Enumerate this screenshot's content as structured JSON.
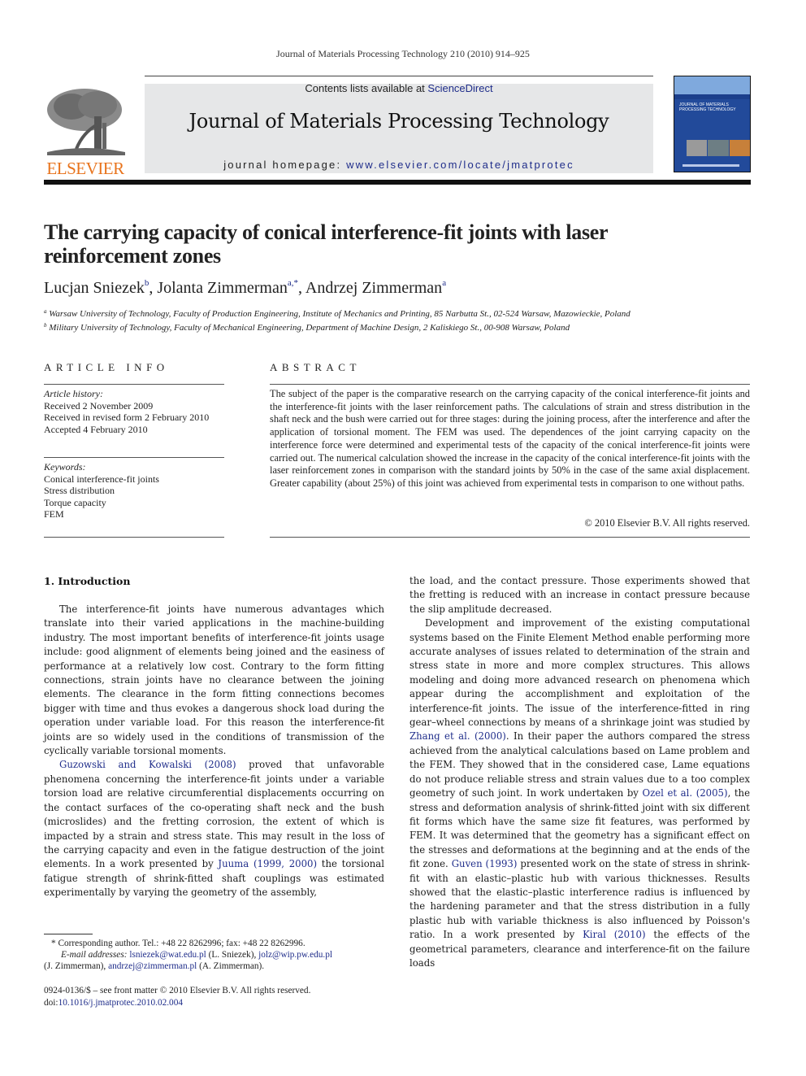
{
  "running_head": "Journal of Materials Processing Technology 210 (2010) 914–925",
  "masthead": {
    "publisher_logo_text": "ELSEVIER",
    "contents_prefix": "Contents lists available at ",
    "contents_link": "ScienceDirect",
    "journal_name": "Journal of Materials Processing Technology",
    "homepage_prefix": "journal homepage: ",
    "homepage_link": "www.elsevier.com/locate/jmatprotec",
    "cover_title_line1": "JOURNAL OF MATERIALS",
    "cover_title_line2": "PROCESSING TECHNOLOGY",
    "brand_color": "#e8731c",
    "link_color": "#1f2d8a",
    "band_color": "#e6e7e8"
  },
  "article": {
    "title": "The carrying capacity of conical interference-fit joints with laser reinforcement zones",
    "authors": [
      {
        "name": "Lucjan Sniezek",
        "sup": "b"
      },
      {
        "name": "Jolanta Zimmerman",
        "sup": "a,*"
      },
      {
        "name": "Andrzej Zimmerman",
        "sup": "a"
      }
    ],
    "affiliations": [
      {
        "mark": "a",
        "text": "Warsaw University of Technology, Faculty of Production Engineering, Institute of Mechanics and Printing, 85 Narbutta St., 02-524 Warsaw, Mazowieckie, Poland"
      },
      {
        "mark": "b",
        "text": "Military University of Technology, Faculty of Mechanical Engineering, Department of Machine Design, 2 Kaliskiego St., 00-908 Warsaw, Poland"
      }
    ]
  },
  "article_info": {
    "heading": "ARTICLE INFO",
    "history_label": "Article history:",
    "history": [
      "Received 2 November 2009",
      "Received in revised form 2 February 2010",
      "Accepted 4 February 2010"
    ],
    "keywords_label": "Keywords:",
    "keywords": [
      "Conical interference-fit joints",
      "Stress distribution",
      "Torque capacity",
      "FEM"
    ]
  },
  "abstract": {
    "heading": "ABSTRACT",
    "text": "The subject of the paper is the comparative research on the carrying capacity of the conical interference-fit joints and the interference-fit joints with the laser reinforcement paths. The calculations of strain and stress distribution in the shaft neck and the bush were carried out for three stages: during the joining process, after the interference and after the application of torsional moment. The FEM was used. The dependences of the joint carrying capacity on the interference force were determined and experimental tests of the capacity of the conical interference-fit joints were carried out. The numerical calculation showed the increase in the capacity of the conical interference-fit joints with the laser reinforcement zones in comparison with the standard joints by 50% in the case of the same axial displacement. Greater capability (about 25%) of this joint was achieved from experimental tests in comparison to one without paths.",
    "copyright": "© 2010 Elsevier B.V. All rights reserved."
  },
  "body": {
    "section_heading": "1.  Introduction",
    "p1": "The interference-fit joints have numerous advantages which translate into their varied applications in the machine-building industry. The most important benefits of interference-fit joints usage include: good alignment of elements being joined and the easiness of performance at a relatively low cost. Contrary to the form fitting connections, strain joints have no clearance between the joining elements. The clearance in the form fitting connections becomes bigger with time and thus evokes a dangerous shock load during the operation under variable load. For this reason the interference-fit joints are so widely used in the conditions of transmission of the cyclically variable torsional moments.",
    "p2_link1": "Guzowski and Kowalski (2008)",
    "p2_a": " proved that unfavorable phenomena concerning the interference-fit joints under a variable torsion load are relative circumferential displacements occurring on the contact surfaces of the co-operating shaft neck and the bush (microslides) and the fretting corrosion, the extent of which is impacted by a strain and stress state. This may result in the loss of the carrying capacity and even in the fatigue destruction of the joint elements. In a work presented by ",
    "p2_link2": "Juuma (1999, 2000)",
    "p2_b": " the torsional fatigue strength of shrink-fitted shaft couplings was estimated experimentally by varying the geometry of the assembly,",
    "r1": "the load, and the contact pressure. Those experiments showed that the fretting is reduced with an increase in contact pressure because the slip amplitude decreased.",
    "r2_a": "Development and improvement of the existing computational systems based on the Finite Element Method enable performing more accurate analyses of issues related to determination of the strain and stress state in more and more complex structures. This allows modeling and doing more advanced research on phenomena which appear during the accomplishment and exploitation of the interference-fit joints. The issue of the interference-fitted in ring gear–wheel connections by means of a shrinkage joint was studied by ",
    "r2_link1": "Zhang et al. (2000)",
    "r2_b": ". In their paper the authors compared the stress achieved from the analytical calculations based on Lame problem and the FEM. They showed that in the considered case, Lame equations do not produce reliable stress and strain values due to a too complex geometry of such joint. In work undertaken by ",
    "r2_link2": "Ozel et al. (2005)",
    "r2_c": ", the stress and deformation analysis of shrink-fitted joint with six different fit forms which have the same size fit features, was performed by FEM. It was determined that the geometry has a significant effect on the stresses and deformations at the beginning and at the ends of the fit zone. ",
    "r2_link3": "Guven (1993)",
    "r2_d": " presented work on the state of stress in shrink-fit with an elastic–plastic hub with various thicknesses. Results showed that the elastic–plastic interference radius is influenced by the hardening parameter and that the stress distribution in a fully plastic hub with variable thickness is also influenced by Poisson's ratio. In a work presented by ",
    "r2_link4": "Kiral (2010)",
    "r2_e": " the effects of the geometrical parameters, clearance and interference-fit on the failure loads"
  },
  "footnotes": {
    "corresponding": "* Corresponding author. Tel.: +48 22 8262996; fax: +48 22 8262996.",
    "email_label": "E-mail addresses:",
    "email1": "lsniezek@wat.edu.pl",
    "email1_who": " (L. Sniezek), ",
    "email2": "jolz@wip.pw.edu.pl",
    "email2_who": "(J. Zimmerman), ",
    "email3": "andrzej@zimmerman.pl",
    "email3_who": " (A. Zimmerman).",
    "issn_line": "0924-0136/$ – see front matter © 2010 Elsevier B.V. All rights reserved.",
    "doi_prefix": "doi:",
    "doi": "10.1016/j.jmatprotec.2010.02.004"
  }
}
